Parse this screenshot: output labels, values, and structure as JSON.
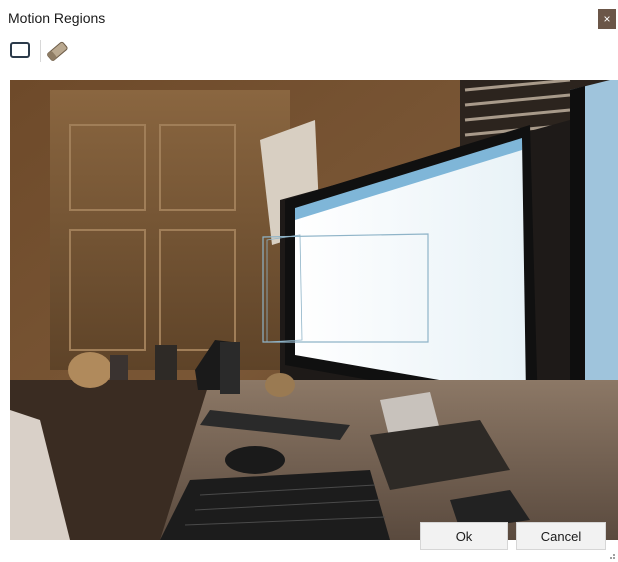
{
  "window": {
    "title": "Motion Regions",
    "close_glyph": "×"
  },
  "toolbar": {
    "tools": [
      {
        "name": "rectangle-tool",
        "icon": "rectangle-icon"
      },
      {
        "name": "eraser-tool",
        "icon": "eraser-icon"
      }
    ]
  },
  "preview": {
    "description_hidden": true
  },
  "buttons": {
    "ok_label": "Ok",
    "cancel_label": "Cancel"
  },
  "colors": {
    "close_bg": "#6b5648",
    "region_outline": "#8fb4c8"
  }
}
